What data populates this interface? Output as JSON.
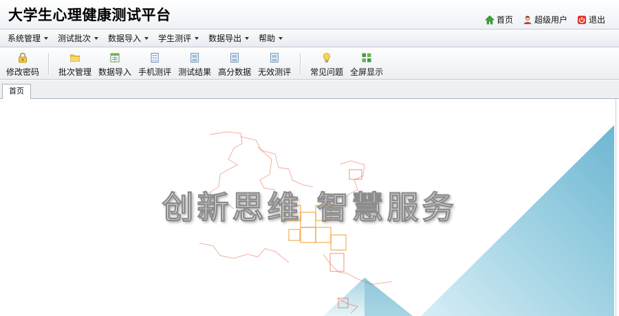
{
  "header": {
    "title": "大学生心理健康测试平台",
    "links": [
      {
        "label": "首页",
        "icon": "home-icon"
      },
      {
        "label": "超级用户",
        "icon": "user-icon"
      },
      {
        "label": "退出",
        "icon": "power-icon"
      }
    ]
  },
  "menubar": {
    "items": [
      "系统管理",
      "测试批次",
      "数据导入",
      "学生测评",
      "数据导出",
      "帮助"
    ]
  },
  "toolbar": {
    "items": [
      {
        "label": "修改密码",
        "icon": "lock-icon"
      },
      {
        "label": "批次管理",
        "icon": "folder-icon"
      },
      {
        "label": "数据导入",
        "icon": "import-icon"
      },
      {
        "label": "手机测评",
        "icon": "phone-icon"
      },
      {
        "label": "测试结果",
        "icon": "document-icon"
      },
      {
        "label": "高分数据",
        "icon": "document-icon"
      },
      {
        "label": "无效测评",
        "icon": "document-icon"
      },
      {
        "label": "常见问题",
        "icon": "bulb-icon"
      },
      {
        "label": "全屏显示",
        "icon": "fullscreen-icon"
      }
    ]
  },
  "tabs": [
    {
      "label": "首页"
    }
  ],
  "content": {
    "slogan": "创新思维   智慧服务"
  },
  "colors": {
    "triangle_blue": "#7cc3da",
    "art_orange": "#e2502a"
  }
}
